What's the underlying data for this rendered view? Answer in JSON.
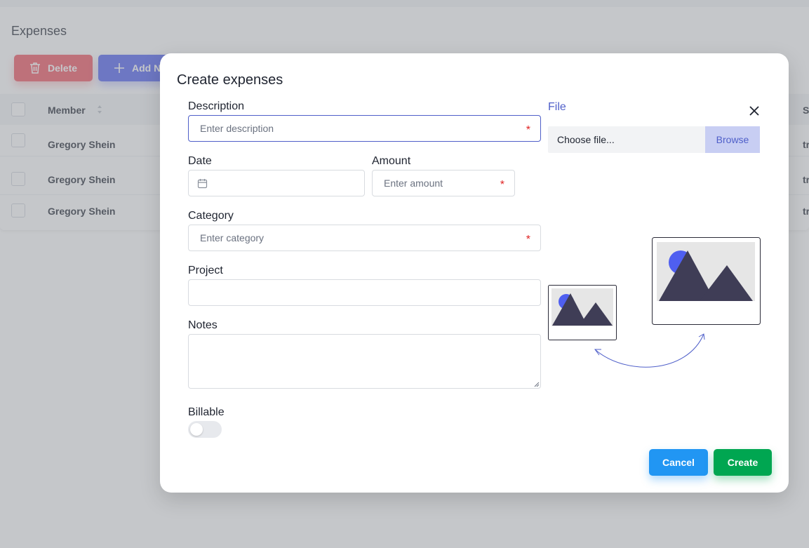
{
  "background": {
    "page_title": "Expenses",
    "delete_label": "Delete",
    "add_label": "Add N",
    "table": {
      "header_member": "Member",
      "header_right": "S",
      "rows": [
        {
          "member": "Gregory Shein",
          "right": "tr"
        },
        {
          "member": "Gregory Shein",
          "right": "tr"
        },
        {
          "member": "Gregory Shein",
          "right": "tr"
        }
      ]
    }
  },
  "modal": {
    "title": "Create expenses",
    "description": {
      "label": "Description",
      "placeholder": "Enter description",
      "required_mark": "*"
    },
    "date": {
      "label": "Date"
    },
    "amount": {
      "label": "Amount",
      "placeholder": "Enter amount",
      "required_mark": "*"
    },
    "category": {
      "label": "Category",
      "placeholder": "Enter category",
      "required_mark": "*"
    },
    "project": {
      "label": "Project"
    },
    "notes": {
      "label": "Notes"
    },
    "billable": {
      "label": "Billable",
      "on": false
    },
    "file": {
      "label": "File",
      "input_text": "Choose file...",
      "browse_label": "Browse"
    },
    "cancel_label": "Cancel",
    "create_label": "Create"
  },
  "colors": {
    "primary": "#4f5fc9",
    "cancel": "#2196f3",
    "create": "#00a651",
    "delete": "#f0525e",
    "required": "#e02424"
  }
}
